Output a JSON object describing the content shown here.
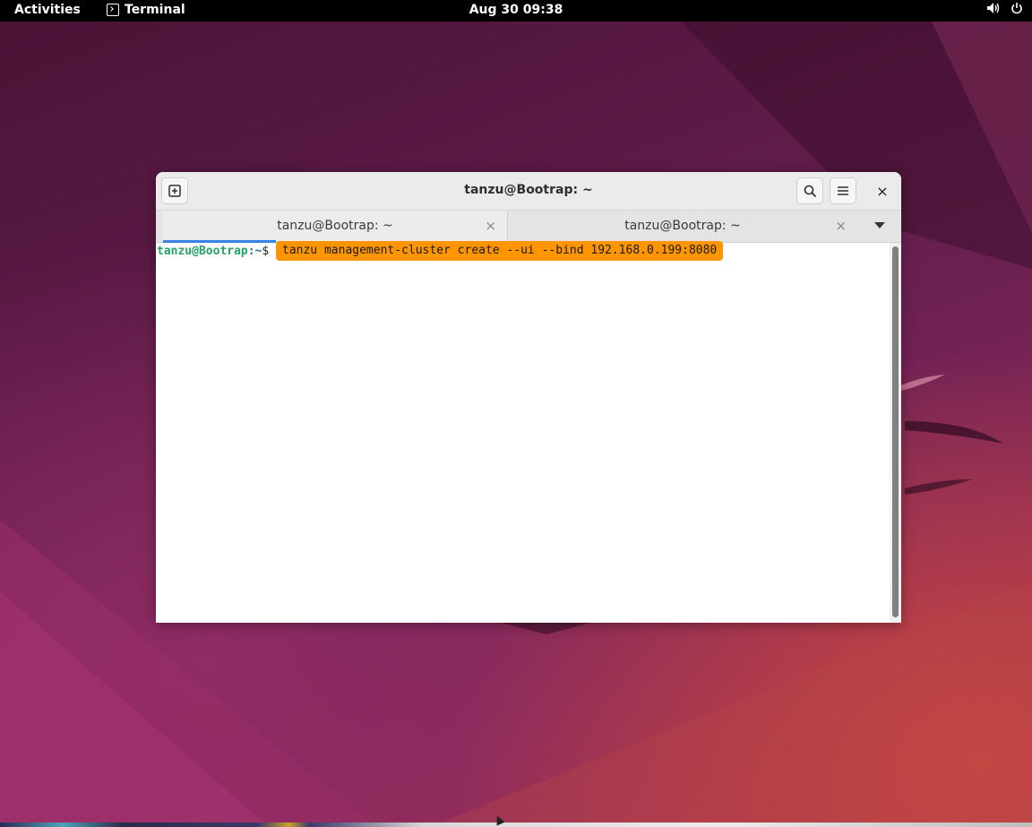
{
  "topbar": {
    "activities_label": "Activities",
    "app_name": "Terminal",
    "clock": "Aug 30  09:38",
    "icons": [
      "volume-icon",
      "power-icon"
    ]
  },
  "window": {
    "title": "tanzu@Bootrap: ~",
    "buttons": [
      "new-tab-icon",
      "search-icon",
      "hamburger-menu-icon",
      "close-icon"
    ],
    "close_glyph": "×",
    "tabs": [
      {
        "label": "tanzu@Bootrap: ~",
        "close_glyph": "×",
        "active": true
      },
      {
        "label": "tanzu@Bootrap: ~",
        "close_glyph": "×",
        "active": false
      }
    ]
  },
  "terminal": {
    "prompt_user": "tanzu@Bootrap",
    "prompt_path": ":~",
    "prompt_symbol": "$ ",
    "command": "tanzu management-cluster create --ui --bind 192.168.0.199:8080"
  },
  "colors": {
    "accent": "#3584e4",
    "highlight": "#ff9500",
    "prompt_user": "#26a269",
    "prompt_path": "#3465a4"
  }
}
